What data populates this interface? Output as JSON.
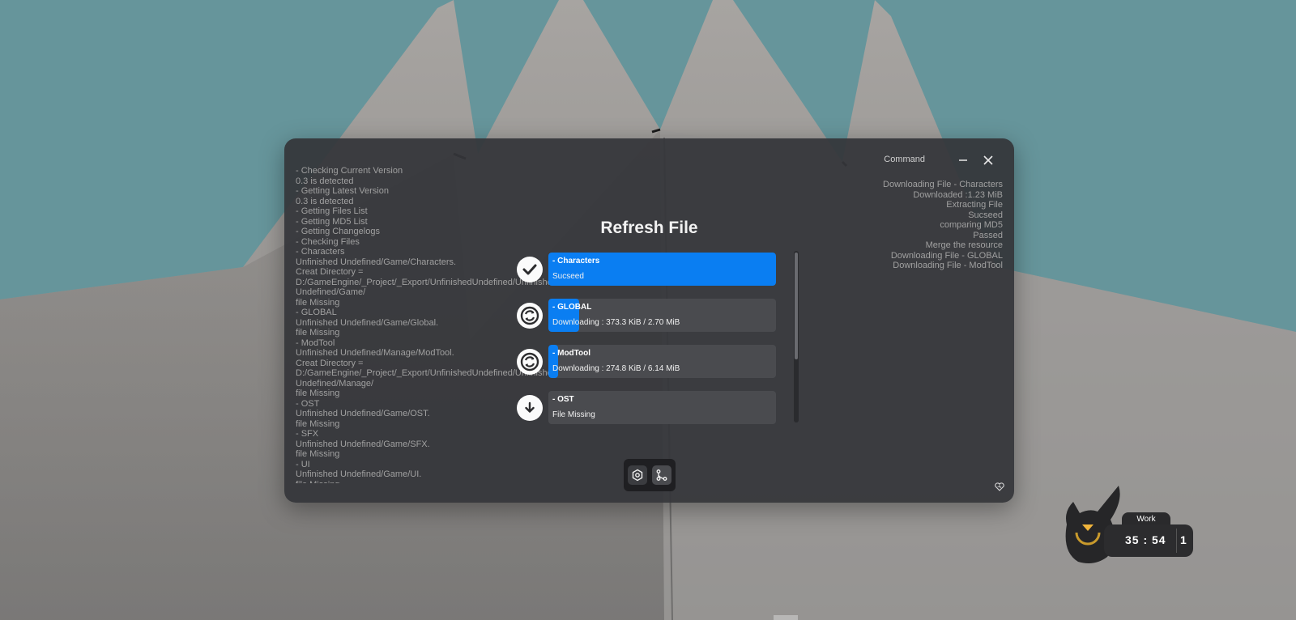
{
  "window": {
    "title_label": "Command",
    "heading": "Refresh File"
  },
  "log_left": [
    "- Checking Current Version",
    "0.3 is detected",
    "- Getting Latest Version",
    "0.3 is detected",
    "- Getting Files List",
    "- Getting MD5 List",
    "- Getting Changelogs",
    "- Checking Files",
    "- Characters",
    "Unfinished Undefined/Game/Characters.",
    "Creat Directory =",
    "D:/GameEngine/_Project/_Export/UnfinishedUndefined/Unfinished",
    "Undefined/Game/",
    "file Missing",
    "- GLOBAL",
    "Unfinished Undefined/Game/Global.",
    "file Missing",
    "- ModTool",
    "Unfinished Undefined/Manage/ModTool.",
    "Creat Directory =",
    "D:/GameEngine/_Project/_Export/UnfinishedUndefined/Unfinished",
    "Undefined/Manage/",
    "file Missing",
    "- OST",
    "Unfinished Undefined/Game/OST.",
    "file Missing",
    "- SFX",
    "Unfinished Undefined/Game/SFX.",
    "file Missing",
    "- UI",
    "Unfinished Undefined/Game/UI.",
    "file Missing"
  ],
  "log_right": [
    "Downloading File - Characters",
    "Downloaded :1.23 MiB",
    "Extracting File",
    "Sucseed",
    "comparing MD5",
    "Passed",
    "Merge the resource",
    "Downloading File - GLOBAL",
    "Downloading File - ModTool"
  ],
  "files": [
    {
      "name": "- Characters",
      "status": "Sucseed",
      "icon": "check-icon",
      "progress": 1.0
    },
    {
      "name": "- GLOBAL",
      "status": "Downloading : 373.3 KiB / 2.70 MiB",
      "icon": "sync-icon",
      "progress": 0.135
    },
    {
      "name": "- ModTool",
      "status": "Downloading : 274.8 KiB / 6.14 MiB",
      "icon": "sync-icon",
      "progress": 0.044
    },
    {
      "name": "- OST",
      "status": "File Missing",
      "icon": "download-icon",
      "progress": 0
    }
  ],
  "toolbar": {
    "buttons": [
      "settings-hex-icon",
      "branch-icon"
    ]
  },
  "widget": {
    "tab_label": "Work",
    "time": "35 : 54",
    "count": "1"
  },
  "colors": {
    "accent": "#0a7ef2",
    "window_bg": "#343539",
    "log_text": "#a0a0a0"
  }
}
